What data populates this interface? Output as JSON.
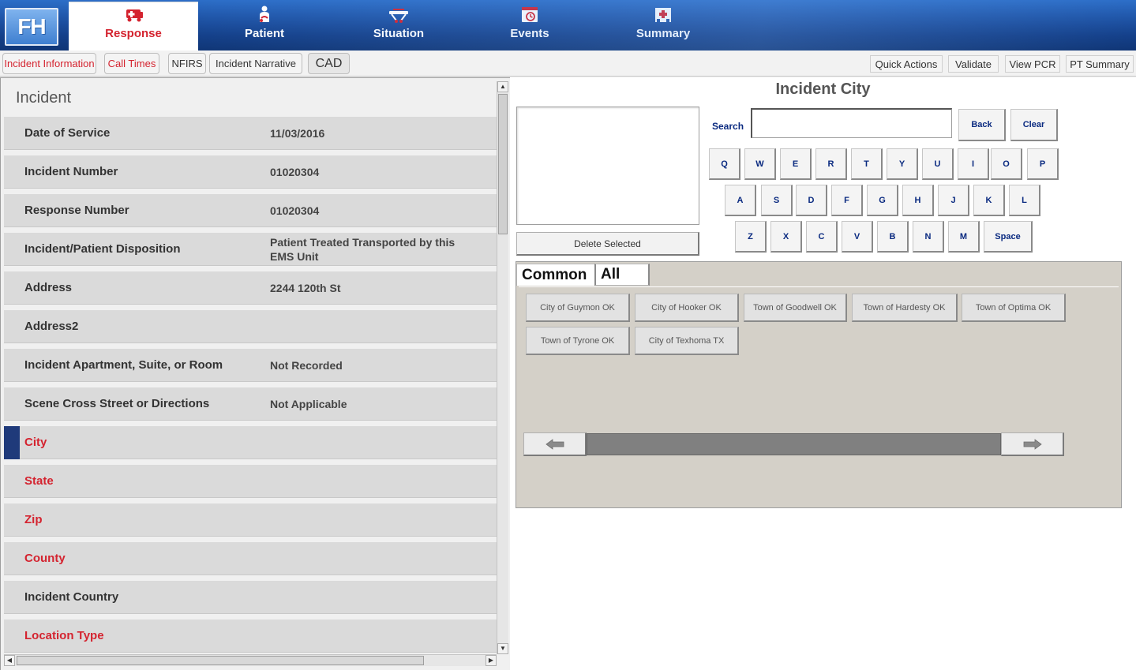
{
  "app": {
    "logo_text": "FH"
  },
  "topnav": [
    {
      "label": "Response",
      "icon": "ambulance-icon",
      "active": true
    },
    {
      "label": "Patient",
      "icon": "patient-icon",
      "active": false
    },
    {
      "label": "Situation",
      "icon": "stretcher-icon",
      "active": false
    },
    {
      "label": "Events",
      "icon": "clock-calendar-icon",
      "active": false
    },
    {
      "label": "Summary",
      "icon": "hospital-icon",
      "active": false
    }
  ],
  "subtabs": [
    "Incident Information",
    "Call Times",
    "NFIRS",
    "Incident Narrative",
    "CAD"
  ],
  "actions": [
    "Quick Actions",
    "Validate",
    "View PCR",
    "PT Summary"
  ],
  "form": {
    "section_title": "Incident",
    "rows": [
      {
        "label": "Date of Service",
        "value": "11/03/2016",
        "required": false
      },
      {
        "label": "Incident Number",
        "value": "01020304",
        "required": false
      },
      {
        "label": "Response Number",
        "value": "01020304",
        "required": false
      },
      {
        "label": "Incident/Patient Disposition",
        "value": "Patient Treated Transported by this EMS Unit",
        "required": false
      },
      {
        "label": "Address",
        "value": "2244 120th St",
        "required": false
      },
      {
        "label": "Address2",
        "value": "",
        "required": false
      },
      {
        "label": "Incident Apartment, Suite, or Room",
        "value": "Not Recorded",
        "required": false
      },
      {
        "label": "Scene Cross Street or Directions",
        "value": "Not Applicable",
        "required": false
      },
      {
        "label": "City",
        "value": "",
        "required": true,
        "selected": true
      },
      {
        "label": "State",
        "value": "",
        "required": true
      },
      {
        "label": "Zip",
        "value": "",
        "required": true
      },
      {
        "label": "County",
        "value": "",
        "required": true
      },
      {
        "label": "Incident Country",
        "value": "",
        "required": false
      },
      {
        "label": "Location Type",
        "value": "",
        "required": true
      }
    ]
  },
  "picker": {
    "title": "Incident City",
    "delete_label": "Delete Selected",
    "search_label": "Search",
    "search_value": "",
    "back_label": "Back",
    "clear_label": "Clear",
    "keyboard": {
      "row1": [
        "Q",
        "W",
        "E",
        "R",
        "T",
        "Y",
        "U",
        "I",
        "O",
        "P"
      ],
      "row2": [
        "A",
        "S",
        "D",
        "F",
        "G",
        "H",
        "J",
        "K",
        "L"
      ],
      "row3": [
        "Z",
        "X",
        "C",
        "V",
        "B",
        "N",
        "M"
      ],
      "space_label": "Space"
    },
    "tabs": [
      "Common",
      "All"
    ],
    "options": [
      "City of Guymon OK",
      "City of Hooker OK",
      "Town of Goodwell OK",
      "Town of Hardesty OK",
      "Town of Optima OK",
      "Town of Tyrone OK",
      "City of Texhoma TX"
    ]
  },
  "colors": {
    "required": "#d4232f",
    "nav_dark": "#14408a",
    "key_text": "#0a2a80",
    "selected_marker": "#1f3a7a"
  }
}
